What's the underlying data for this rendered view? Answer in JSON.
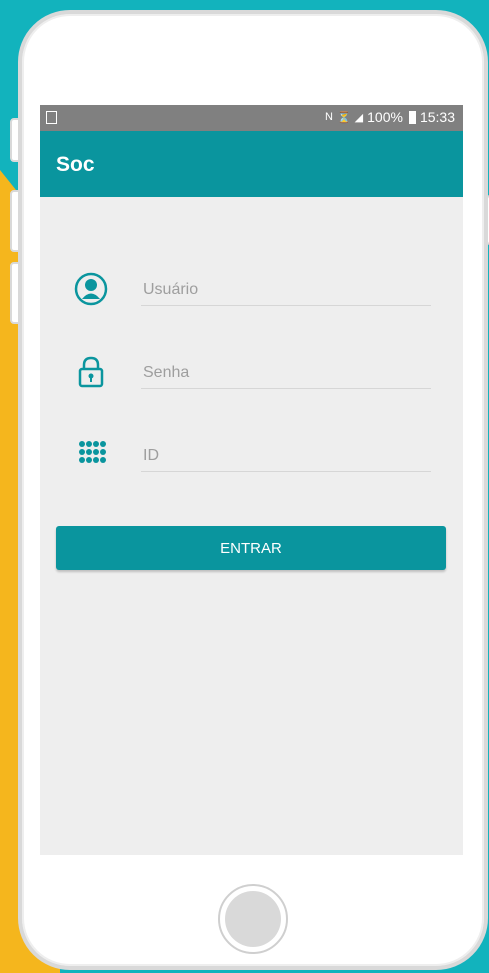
{
  "status_bar": {
    "battery": "100%",
    "time": "15:33"
  },
  "app_bar": {
    "title": "Soc"
  },
  "form": {
    "user_placeholder": "Usuário",
    "password_placeholder": "Senha",
    "id_placeholder": "ID",
    "submit_label": "ENTRAR"
  },
  "colors": {
    "accent": "#0a959e",
    "background_teal": "#12b3bd",
    "background_yellow": "#f5b61d",
    "screen_bg": "#eeeeee"
  },
  "icons": [
    "user-icon",
    "lock-icon",
    "keypad-icon"
  ]
}
